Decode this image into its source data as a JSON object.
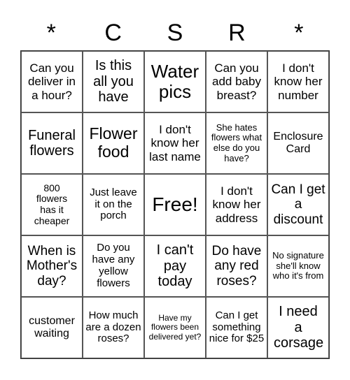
{
  "header": [
    "*",
    "C",
    "S",
    "R",
    "*"
  ],
  "cells": [
    "Can you deliver in a hour?",
    "Is this all you have",
    "Water pics",
    "Can you add baby breast?",
    "I don't know her number",
    "Funeral flowers",
    "Flower food",
    "I don't know her last name",
    "She hates flowers what else do you have?",
    "Enclosure Card",
    "800 flowers has it cheaper",
    "Just leave it on the porch",
    "Free!",
    "I don't know her address",
    "Can I get a discount",
    "When is Mother's day?",
    "Do you have any yellow flowers",
    "I can't pay today",
    "Do have any red roses?",
    "No signature she'll know who it's from",
    "customer waiting",
    "How much are a dozen roses?",
    "Have my flowers been delivered yet?",
    "Can I get something nice for $25",
    "I need a corsage"
  ]
}
